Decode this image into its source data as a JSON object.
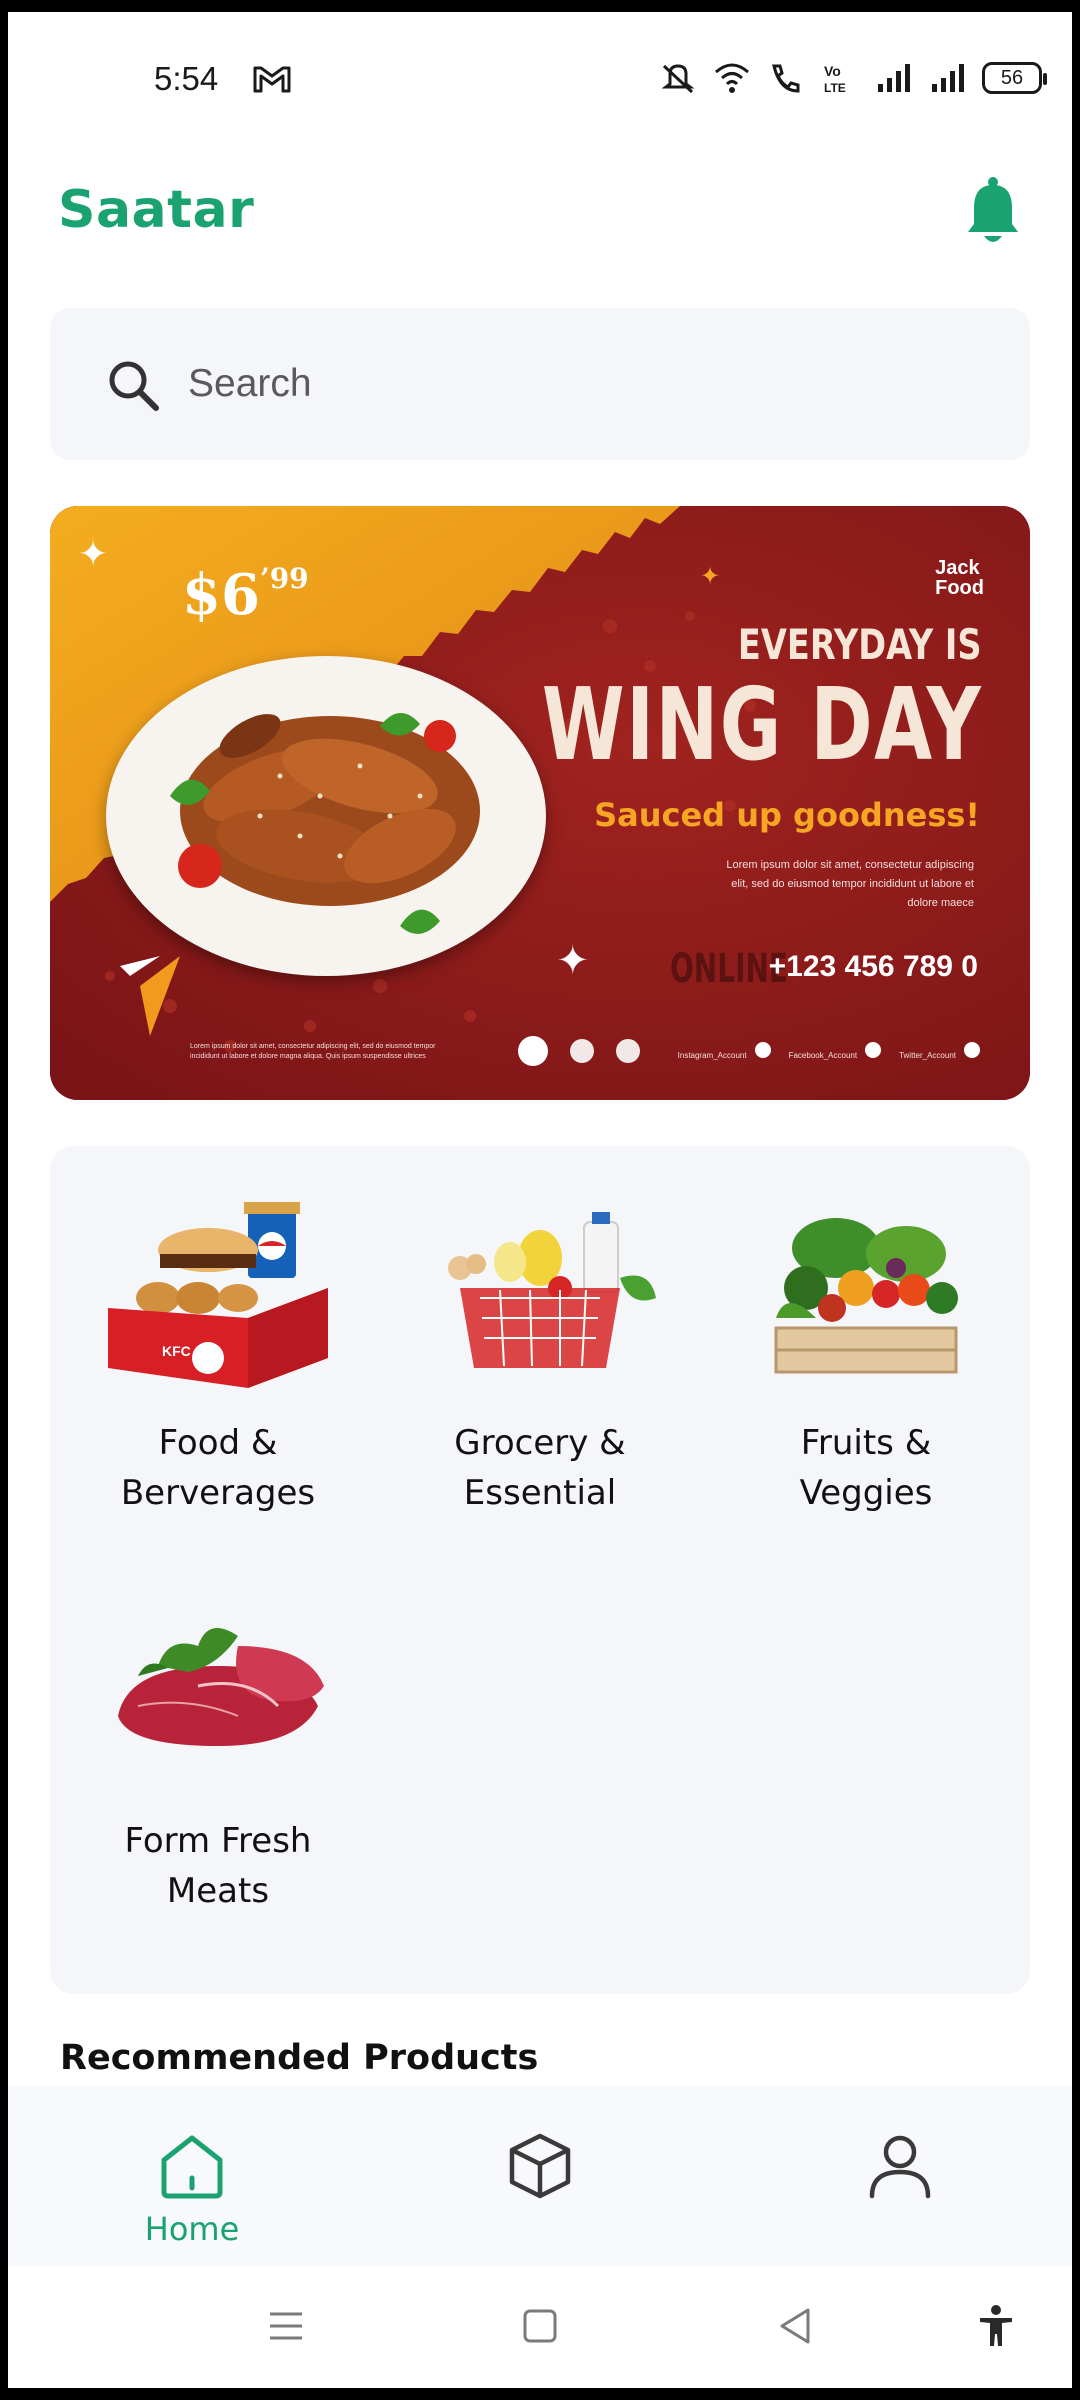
{
  "status_bar": {
    "time": "5:54",
    "battery": "56"
  },
  "header": {
    "brand": "Saatar"
  },
  "search": {
    "placeholder": "Search"
  },
  "banner": {
    "price_main": "$6",
    "price_cents": "99",
    "logo_line1": "Jack",
    "logo_line2": "Food",
    "headline1": "EVERYDAY IS",
    "headline2": "WING DAY",
    "tagline": "Sauced up goodness!",
    "lorem": "Lorem ipsum dolor sit amet, consectetur adipiscing elit, sed do eiusmod tempor incididunt ut labore et dolore maece",
    "phone": "+123 456 789 0",
    "online": "ONLINE",
    "footer_text": "Lorem ipsum dolor sit amet, consectetur adipiscing elit, sed do eiusmod tempor incididunt ut labore et dolore magna aliqua. Quis ipsum suspendisse ultrices",
    "social_instagram": "Instagram_Account",
    "social_facebook": "Facebook_Account",
    "social_twitter": "Twitter_Account",
    "slide_count": 3,
    "active_slide": 1
  },
  "categories": [
    {
      "line1": "Food &",
      "line2": "Berverages"
    },
    {
      "line1": "Grocery &",
      "line2": "Essential"
    },
    {
      "line1": "Fruits &",
      "line2": "Veggies"
    },
    {
      "line1": "Form Fresh",
      "line2": "Meats"
    }
  ],
  "sections": {
    "recommended_title": "Recommended Products"
  },
  "bottom_nav": {
    "home_label": "Home",
    "accent": "#1aa270"
  }
}
